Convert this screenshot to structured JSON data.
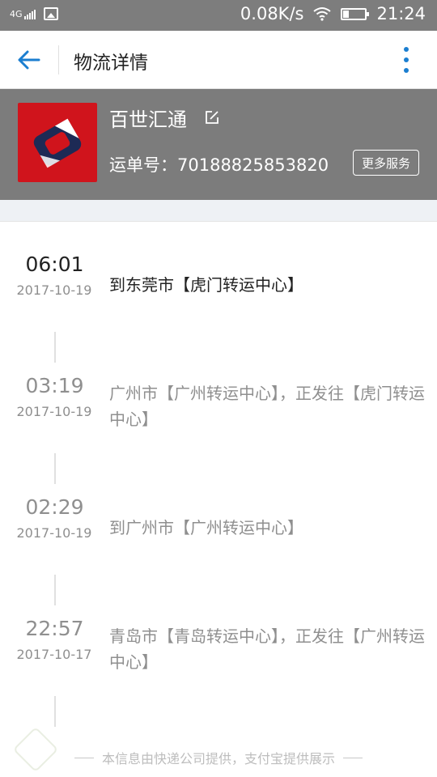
{
  "status_bar": {
    "network": "4G",
    "speed": "0.08K/s",
    "time": "21:24"
  },
  "app_bar": {
    "title": "物流详情"
  },
  "courier": {
    "name": "百世汇通",
    "waybill_label": "运单号：",
    "waybill_number": "70188825853820",
    "more_services": "更多服务",
    "brand_color": "#d0141c"
  },
  "timeline": [
    {
      "time": "06:01",
      "date": "2017-10-19",
      "description": "到东莞市【虎门转运中心】",
      "latest": true
    },
    {
      "time": "03:19",
      "date": "2017-10-19",
      "description": "广州市【广州转运中心】，正发往【虎门转运中心】",
      "latest": false
    },
    {
      "time": "02:29",
      "date": "2017-10-19",
      "description": "到广州市【广州转运中心】",
      "latest": false
    },
    {
      "time": "22:57",
      "date": "2017-10-17",
      "description": "青岛市【青岛转运中心】，正发往【广州转运中心】",
      "latest": false
    }
  ],
  "footer": {
    "text": "本信息由快递公司提供，支付宝提供展示"
  },
  "colors": {
    "status_bar": "#7d7d7d",
    "accent": "#1b7ed0",
    "panel": "#7c7c7c",
    "latest_text": "#222222",
    "older_text": "#8f8f8f"
  }
}
